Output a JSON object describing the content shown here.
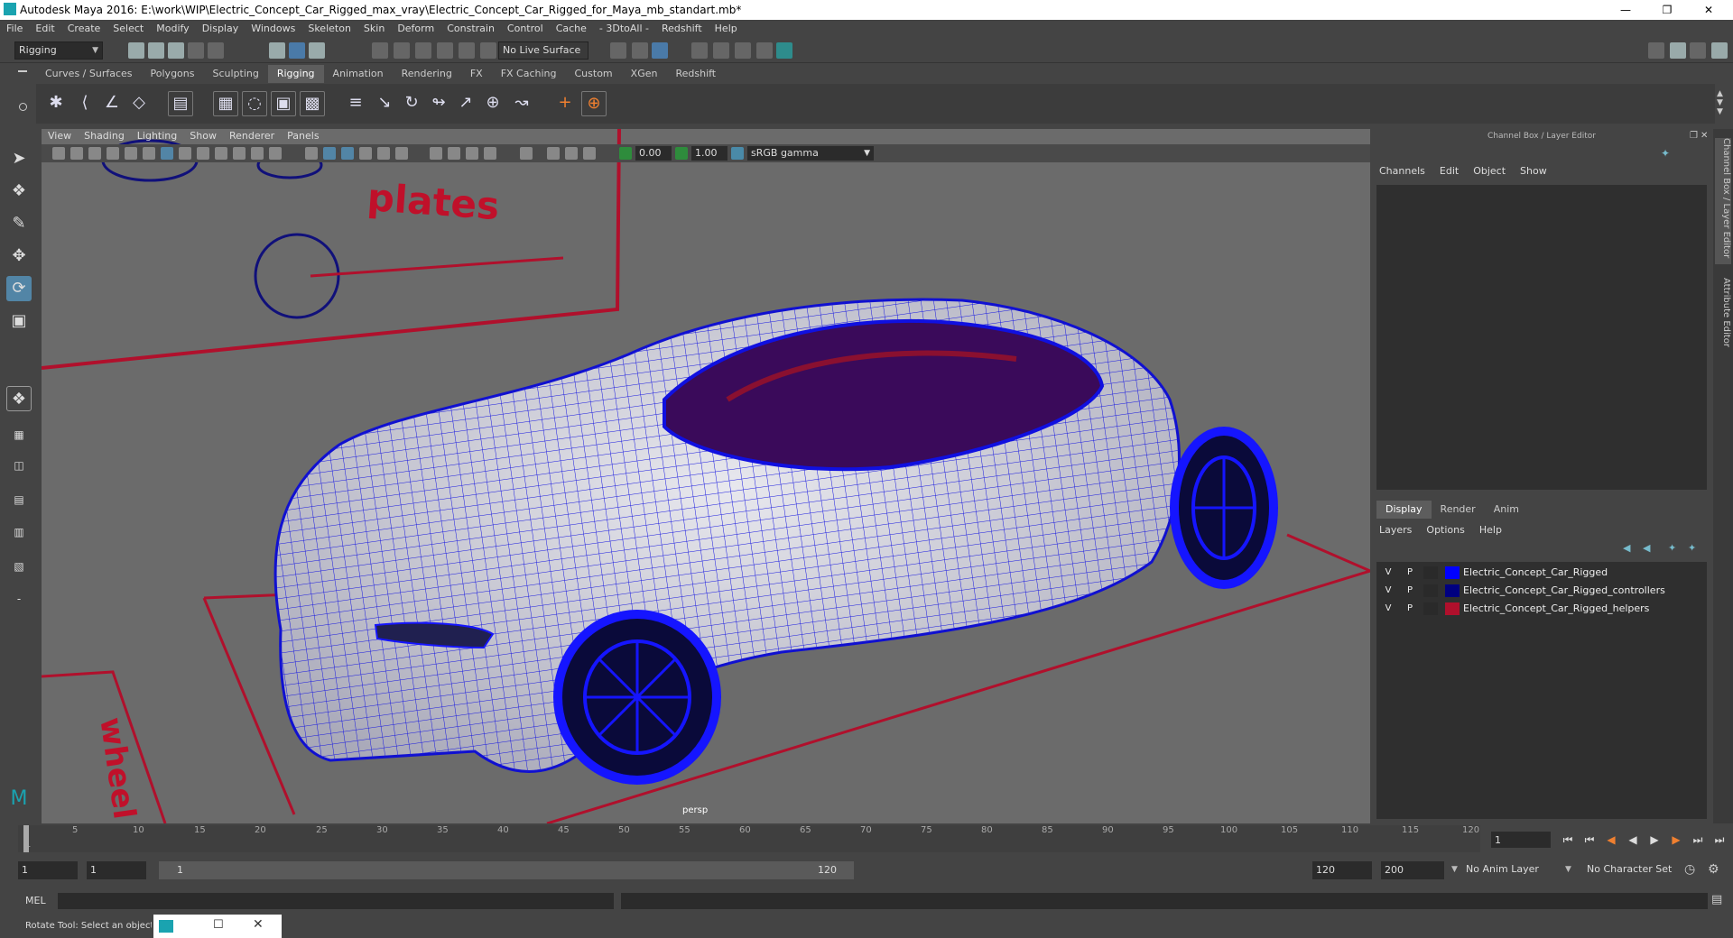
{
  "window": {
    "title": "Autodesk Maya 2016: E:\\work\\WIP\\Electric_Concept_Car_Rigged_max_vray\\Electric_Concept_Car_Rigged_for_Maya_mb_standart.mb*"
  },
  "menus": [
    "File",
    "Edit",
    "Create",
    "Select",
    "Modify",
    "Display",
    "Windows",
    "Skeleton",
    "Skin",
    "Deform",
    "Constrain",
    "Control",
    "Cache",
    "- 3DtoAll -",
    "Redshift",
    "Help"
  ],
  "statusline": {
    "mode": "Rigging",
    "live_surface": "No Live Surface"
  },
  "shelf_tabs": [
    "Curves / Surfaces",
    "Polygons",
    "Sculpting",
    "Rigging",
    "Animation",
    "Rendering",
    "FX",
    "FX Caching",
    "Custom",
    "XGen",
    "Redshift"
  ],
  "active_shelf_tab": "Rigging",
  "viewport": {
    "menus": [
      "View",
      "Shading",
      "Lighting",
      "Show",
      "Renderer",
      "Panels"
    ],
    "exposure": "0.00",
    "gamma": "1.00",
    "color_space": "sRGB gamma",
    "camera": "persp",
    "scene_text_plates": "plates",
    "scene_text_side": "wheel"
  },
  "right_panel": {
    "title": "Channel Box / Layer Editor",
    "channel_menus": [
      "Channels",
      "Edit",
      "Object",
      "Show"
    ],
    "layer_tabs": [
      "Display",
      "Render",
      "Anim"
    ],
    "active_layer_tab": "Display",
    "layer_menus": [
      "Layers",
      "Options",
      "Help"
    ],
    "layers": [
      {
        "v": "V",
        "p": "P",
        "name": "Electric_Concept_Car_Rigged",
        "color": "#0000ff"
      },
      {
        "v": "V",
        "p": "P",
        "name": "Electric_Concept_Car_Rigged_controllers",
        "color": "#000080"
      },
      {
        "v": "V",
        "p": "P",
        "name": "Electric_Concept_Car_Rigged_helpers",
        "color": "#b0102c"
      }
    ],
    "side_tabs": [
      "Channel Box / Layer Editor",
      "Attribute Editor"
    ]
  },
  "timeline": {
    "ticks": [
      "1",
      "5",
      "10",
      "15",
      "20",
      "25",
      "30",
      "35",
      "40",
      "45",
      "50",
      "55",
      "60",
      "65",
      "70",
      "75",
      "80",
      "85",
      "90",
      "95",
      "100",
      "105",
      "110",
      "115",
      "120"
    ],
    "current_frame": "1"
  },
  "range": {
    "start": "1",
    "playback_start": "1",
    "slider_start": "1",
    "slider_end": "120",
    "playback_end": "120",
    "end": "200",
    "anim_layer": "No Anim Layer",
    "character_set": "No Character Set"
  },
  "mel": {
    "label": "MEL"
  },
  "help_line": "Rotate Tool: Select an object to"
}
